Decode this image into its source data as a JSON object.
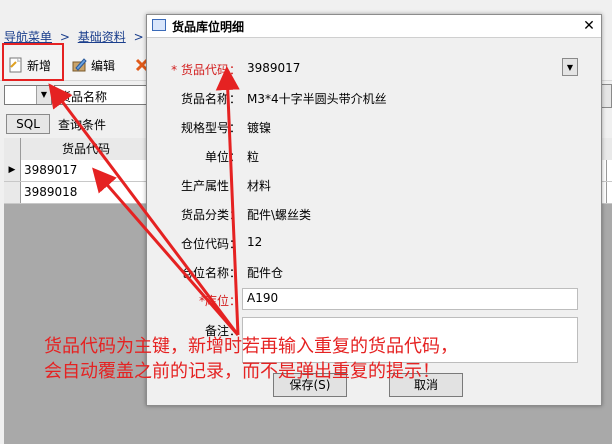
{
  "breadcrumb": [
    "导航菜单",
    ">",
    "基础资料",
    ">"
  ],
  "toolbar": {
    "new_label": "新增",
    "edit_label": "编辑"
  },
  "query": {
    "field_value": "货品名称",
    "sql_label": "SQL",
    "condition_label": "查询条件"
  },
  "grid": {
    "header": "货品代码",
    "rows": [
      {
        "code": "3989017"
      },
      {
        "code": "3989018"
      }
    ]
  },
  "dialog": {
    "title": "货品库位明细",
    "close": "✕",
    "fields": {
      "code": {
        "label": "* 货品代码：",
        "value": "3989017"
      },
      "name": {
        "label": "货品名称：",
        "value": "M3*4十字半圆头带介机丝"
      },
      "spec": {
        "label": "规格型号：",
        "value": "镀镍"
      },
      "unit": {
        "label": "单位：",
        "value": "粒"
      },
      "attr": {
        "label": "生产属性：",
        "value": "材料"
      },
      "category": {
        "label": "货品分类：",
        "value": "配件\\螺丝类"
      },
      "wh_code": {
        "label": "仓位代码：",
        "value": "12"
      },
      "wh_name": {
        "label": "仓位名称：",
        "value": "配件仓"
      },
      "location": {
        "label": "*库位：",
        "value": "A190"
      },
      "remark": {
        "label": "备注：",
        "value": ""
      }
    },
    "save_label": "保存(S)",
    "cancel_label": "取消"
  },
  "annotation": {
    "line1": "货品代码为主键，新增时若再输入重复的货品代码，",
    "line2": "会自动覆盖之前的记录，而不是弹出重复的提示！",
    "color": "#e52222"
  }
}
